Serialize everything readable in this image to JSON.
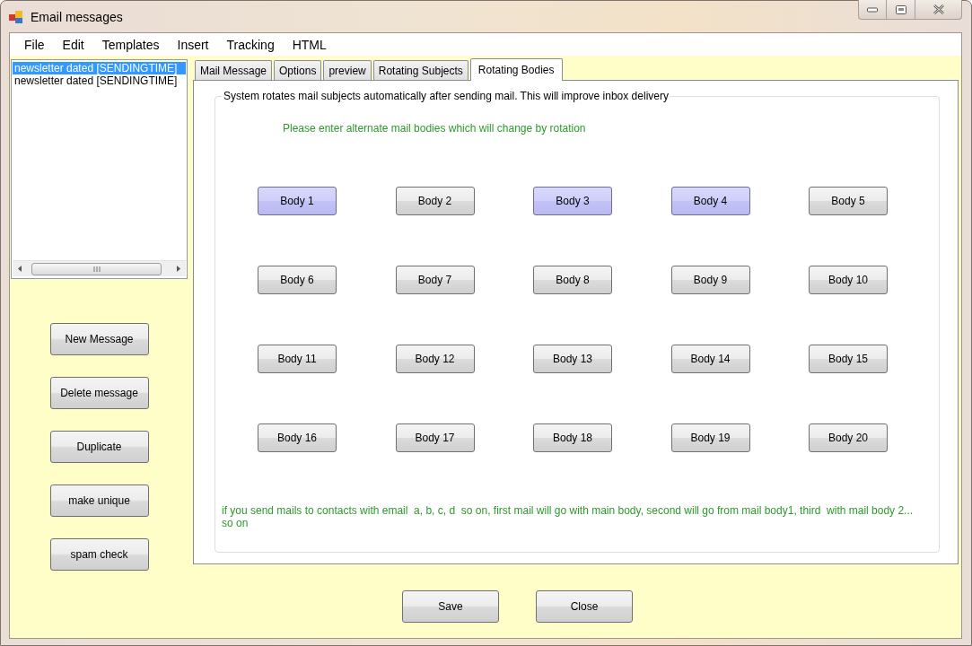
{
  "window": {
    "title": "Email messages"
  },
  "menu": [
    "File",
    "Edit",
    "Templates",
    "Insert",
    "Tracking",
    "HTML"
  ],
  "message_list": {
    "items": [
      {
        "label": "newsletter dated [SENDINGTIME]",
        "selected": true
      },
      {
        "label": "newsletter dated [SENDINGTIME]",
        "selected": false
      }
    ]
  },
  "actions": [
    "New Message",
    "Delete message",
    "Duplicate",
    "make unique",
    "spam check"
  ],
  "tabs": [
    {
      "label": "Mail Message",
      "selected": false
    },
    {
      "label": "Options",
      "selected": false
    },
    {
      "label": "preview",
      "selected": false
    },
    {
      "label": "Rotating Subjects",
      "selected": false
    },
    {
      "label": "Rotating Bodies",
      "selected": true
    }
  ],
  "group": {
    "legend": "System rotates mail subjects automatically after sending mail. This will improve inbox delivery",
    "instruction": "Please enter alternate mail bodies which will change by rotation",
    "bodies": [
      {
        "label": "Body 1",
        "highlighted": true
      },
      {
        "label": "Body 2",
        "highlighted": false
      },
      {
        "label": "Body 3",
        "highlighted": true
      },
      {
        "label": "Body 4",
        "highlighted": true
      },
      {
        "label": "Body 5",
        "highlighted": false
      },
      {
        "label": "Body 6",
        "highlighted": false
      },
      {
        "label": "Body 7",
        "highlighted": false
      },
      {
        "label": "Body 8",
        "highlighted": false
      },
      {
        "label": "Body 9",
        "highlighted": false
      },
      {
        "label": "Body 10",
        "highlighted": false
      },
      {
        "label": "Body 11",
        "highlighted": false
      },
      {
        "label": "Body 12",
        "highlighted": false
      },
      {
        "label": "Body 13",
        "highlighted": false
      },
      {
        "label": "Body 14",
        "highlighted": false
      },
      {
        "label": "Body 15",
        "highlighted": false
      },
      {
        "label": "Body 16",
        "highlighted": false
      },
      {
        "label": "Body 17",
        "highlighted": false
      },
      {
        "label": "Body 18",
        "highlighted": false
      },
      {
        "label": "Body 19",
        "highlighted": false
      },
      {
        "label": "Body 20",
        "highlighted": false
      }
    ],
    "note": "if you send mails to contacts with email  a, b, c, d  so on, first mail will go with main body, second will go from mail body1, third  with mail body 2... so on"
  },
  "footer_buttons": [
    "Save",
    "Close"
  ]
}
